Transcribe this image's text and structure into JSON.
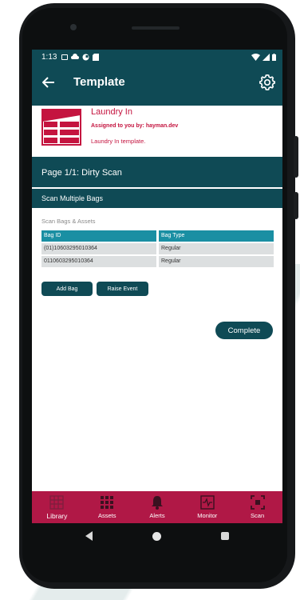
{
  "status_bar": {
    "time": "1:13"
  },
  "header": {
    "title": "Template",
    "back_icon": "arrow-back-icon",
    "settings_icon": "gear-icon"
  },
  "template_card": {
    "name": "Laundry In",
    "assigned": "Assigned to you by: hayman.dev",
    "description": "Laundry In template."
  },
  "page_title": "Page 1/1: Dirty Scan",
  "section_title": "Scan Multiple Bags",
  "scan_label": "Scan Bags & Assets",
  "table": {
    "headers": [
      "Bag ID",
      "Bag Type"
    ],
    "rows": [
      [
        "(01)10603295010364",
        "Regular"
      ],
      [
        "0110603295010364",
        "Regular"
      ]
    ]
  },
  "buttons": {
    "add_bag": "Add Bag",
    "raise_event": "Raise Event",
    "complete": "Complete"
  },
  "tabs": [
    {
      "label": "Library",
      "icon": "library-icon",
      "active": true
    },
    {
      "label": "Assets",
      "icon": "assets-grid-icon",
      "active": false
    },
    {
      "label": "Alerts",
      "icon": "bell-icon",
      "active": false
    },
    {
      "label": "Monitor",
      "icon": "monitor-icon",
      "active": false
    },
    {
      "label": "Scan",
      "icon": "scan-icon",
      "active": false
    }
  ],
  "colors": {
    "primary": "#0f4a55",
    "accent": "#c4143f",
    "tab_bar": "#b01846",
    "table_header": "#1a8fa3"
  }
}
